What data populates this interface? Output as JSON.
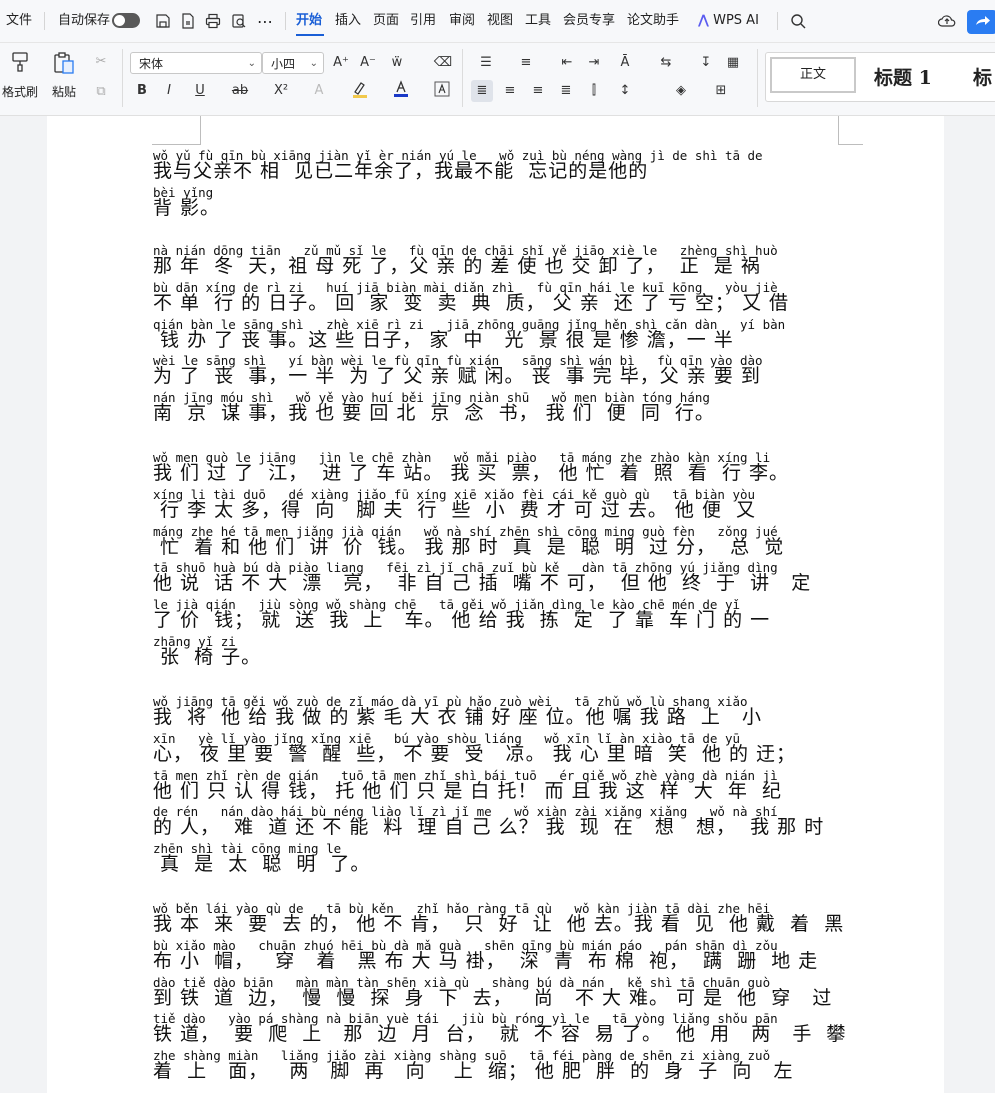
{
  "menubar": {
    "file": "文件",
    "autosave": "自动保存",
    "tabs": [
      "开始",
      "插入",
      "页面",
      "引用",
      "审阅",
      "视图",
      "工具",
      "会员专享",
      "论文助手"
    ],
    "wps_ai": "WPS AI"
  },
  "ribbon": {
    "format_painter": "格式刷",
    "paste": "粘贴",
    "font_name": "宋体",
    "font_size": "小四",
    "styles": {
      "normal": "正文",
      "heading1": "标题 1",
      "heading2": "标"
    }
  },
  "document": {
    "lines": [
      {
        "type": "py",
        "text": "wǒ yǔ fù qīn bù xiāng jiàn yǐ èr nián yú le   wǒ zuì bù néng wàng jì de shì tā de"
      },
      {
        "type": "hz",
        "text": "我与父亲不 相  见已二年余了，我最不能  忘记的是他的"
      },
      {
        "type": "py",
        "text": "bèi yǐng"
      },
      {
        "type": "hz",
        "text": "背 影。"
      },
      {
        "type": "py",
        "text": "nà nián dōng tiān   zǔ mǔ sǐ le   fù qīn de chāi shǐ yě jiāo xiè le   zhèng shì huò"
      },
      {
        "type": "hz",
        "text": "那 年  冬  天，祖 母 死 了，父 亲 的 差 使 也 交 卸 了，  正  是 祸"
      },
      {
        "type": "py",
        "text": "bù dān xíng de rì zi   huí jiā biàn mài diǎn zhì   fù qīn hái le kuī kōng   yòu jiè"
      },
      {
        "type": "hz",
        "text": "不 单  行 的 日子。 回  家  变  卖  典  质， 父 亲  还 了 亏 空； 又 借"
      },
      {
        "type": "py",
        "text": "qián bàn le sāng shì   zhè xiē rì zi   jiā zhōng guāng jǐng hěn shì cǎn dàn   yí bàn"
      },
      {
        "type": "hz",
        "text": " 钱 办 了 丧 事。这 些 日子， 家  中   光  景 很 是 惨 澹，一 半"
      },
      {
        "type": "py",
        "text": "wèi le sāng shì   yí bàn wèi le fù qīn fù xián   sāng shì wán bì   fù qīn yào dào"
      },
      {
        "type": "hz",
        "text": "为 了  丧  事，一 半  为 了 父 亲 赋 闲。 丧  事 完 毕，父 亲 要 到"
      },
      {
        "type": "py",
        "text": "nán jīng móu shì   wǒ yě yào huí běi jīng niàn shū   wǒ men biàn tóng háng"
      },
      {
        "type": "hz",
        "text": "南  京  谋 事，我 也 要 回 北  京  念  书， 我 们  便  同  行。"
      },
      {
        "type": "py",
        "text": "wǒ men guò le jiāng   jìn le chē zhàn   wǒ mǎi piào   tā máng zhe zhào kàn xíng li"
      },
      {
        "type": "hz",
        "text": "我 们 过 了  江，  进 了 车 站。 我 买  票， 他 忙  着  照  看  行 李。"
      },
      {
        "type": "py",
        "text": "xíng li tài duō   dé xiàng jiǎo fū xíng xiē xiǎo fèi cái kě guò qù   tā biàn yòu"
      },
      {
        "type": "hz",
        "text": " 行 李 太 多，得  向   脚 夫  行  些  小  费 才 可 过 去。 他 便  又"
      },
      {
        "type": "py",
        "text": "máng zhe hé tā men jiǎng jià qián   wǒ nà shí zhēn shì cōng ming guò fèn   zǒng jué"
      },
      {
        "type": "hz",
        "text": " 忙  着 和 他 们  讲  价  钱。 我 那 时  真  是  聪  明  过 分，  总  觉"
      },
      {
        "type": "py",
        "text": "tā shuō huà bú dà piào liang   fēi zì jǐ chā zuǐ bù kě   dàn tā zhōng yú jiǎng dìng"
      },
      {
        "type": "hz",
        "text": "他 说  话 不 大  漂   亮，  非 自 己 插  嘴 不 可，  但 他  终  于  讲   定"
      },
      {
        "type": "py",
        "text": "le jià qián   jiù sòng wǒ shàng chē   tā gěi wǒ jiǎn dìng le kào chē mén de yǐ"
      },
      {
        "type": "hz",
        "text": "了 价  钱； 就  送  我  上   车。 他 给 我  拣  定  了 靠  车 门 的 一"
      },
      {
        "type": "py",
        "text": "zhāng yǐ zi"
      },
      {
        "type": "hz",
        "text": " 张  椅 子。"
      },
      {
        "type": "py",
        "text": "wǒ jiāng tā gěi wǒ zuò de zǐ máo dà yī pù hǎo zuò wèi   tā zhǔ wǒ lù shang xiǎo"
      },
      {
        "type": "hz",
        "text": "我  将  他 给 我 做 的 紫 毛 大 衣 铺 好 座 位。他 嘱 我 路  上   小"
      },
      {
        "type": "py",
        "text": "xīn   yè lǐ yào jǐng xǐng xiē   bú yào shòu liáng   wǒ xīn lǐ àn xiào tā de yū"
      },
      {
        "type": "hz",
        "text": "心， 夜 里 要  警  醒  些， 不 要  受   凉。 我 心 里 暗  笑  他 的 迂；"
      },
      {
        "type": "py",
        "text": "tā men zhǐ rèn de qián   tuō tā men zhǐ shì bái tuō   ér qiě wǒ zhè yàng dà nián jì"
      },
      {
        "type": "hz",
        "text": "他 们 只 认 得 钱， 托 他 们 只 是 白 托！ 而 且 我 这  样  大  年  纪"
      },
      {
        "type": "py",
        "text": "de rén   nán dào hái bù néng liào lǐ zì jǐ me   wǒ xiàn zài xiǎng xiǎng   wǒ nà shí"
      },
      {
        "type": "hz",
        "text": "的 人，  难  道 还 不 能  料  理 自 己 么？ 我  现  在   想   想，  我 那 时"
      },
      {
        "type": "py",
        "text": "zhēn shì tài cōng ming le"
      },
      {
        "type": "hz",
        "text": " 真  是  太  聪  明  了。"
      },
      {
        "type": "py",
        "text": "wǒ běn lái yào qù de   tā bù kěn   zhǐ hǎo ràng tā qù   wǒ kàn jiàn tā dài zhe hēi"
      },
      {
        "type": "hz",
        "text": "我 本  来  要  去 的， 他 不 肯，  只  好  让  他 去。我 看  见  他 戴  着  黑"
      },
      {
        "type": "py",
        "text": "bù xiǎo mào   chuān zhuó hēi bù dà mǎ guà   shēn qīng bù mián páo   pán shān dì zǒu"
      },
      {
        "type": "hz",
        "text": "布 小  帽，   穿   着   黑 布 大 马 褂，  深  青  布 棉  袍，  蹒  跚  地 走"
      },
      {
        "type": "py",
        "text": "dào tiě dào biān   màn màn tàn shēn xià qù   shàng bú dà nán   kě shì tā chuān guò"
      },
      {
        "type": "hz",
        "text": "到 铁  道  边，  慢  慢  探  身  下  去，   尚   不 大 难。 可 是  他  穿   过"
      },
      {
        "type": "py",
        "text": "tiě dào   yào pá shàng nà biān yuè tái   jiù bù róng yì le   tā yòng liǎng shǒu pān"
      },
      {
        "type": "hz",
        "text": "铁 道，  要  爬  上   那  边  月  台，  就  不 容  易 了。  他  用   两   手  攀"
      },
      {
        "type": "py",
        "text": "zhe shàng miàn   liǎng jiǎo zài xiàng shàng suō   tā féi pàng de shēn zi xiàng zuǒ"
      },
      {
        "type": "hz",
        "text": "着  上   面，   两   脚  再   向    上  缩； 他 肥  胖  的  身  子  向   左"
      }
    ]
  }
}
